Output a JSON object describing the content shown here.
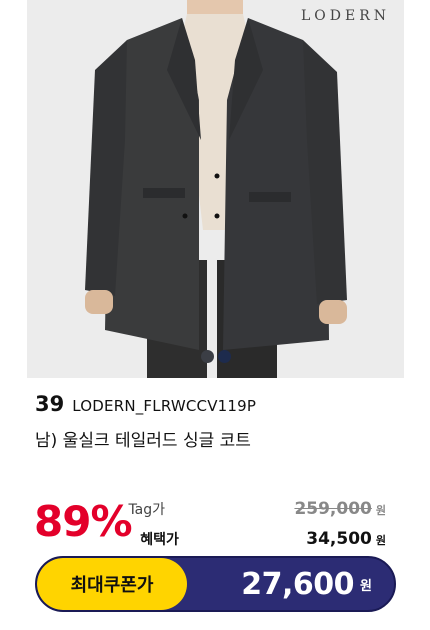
{
  "product": {
    "brand_logo": "LODERN",
    "rank": "39",
    "model_code": "LODERN_FLRWCCV119P",
    "name": "남) 울실크 테일러드 싱글 코트",
    "image_dots": [
      {
        "active": false
      },
      {
        "active": true
      }
    ]
  },
  "pricing": {
    "discount": "89%",
    "tag_label": "Tag가",
    "tag_price": "259,000",
    "benefit_label": "혜택가",
    "benefit_price": "34,500",
    "currency": "원"
  },
  "coupon": {
    "label": "최대쿠폰가",
    "price": "27,600",
    "currency": "원"
  },
  "colors": {
    "discount": "#e3002a",
    "coupon_label_bg": "#ffd400",
    "coupon_bar_bg": "#2c2c74"
  }
}
